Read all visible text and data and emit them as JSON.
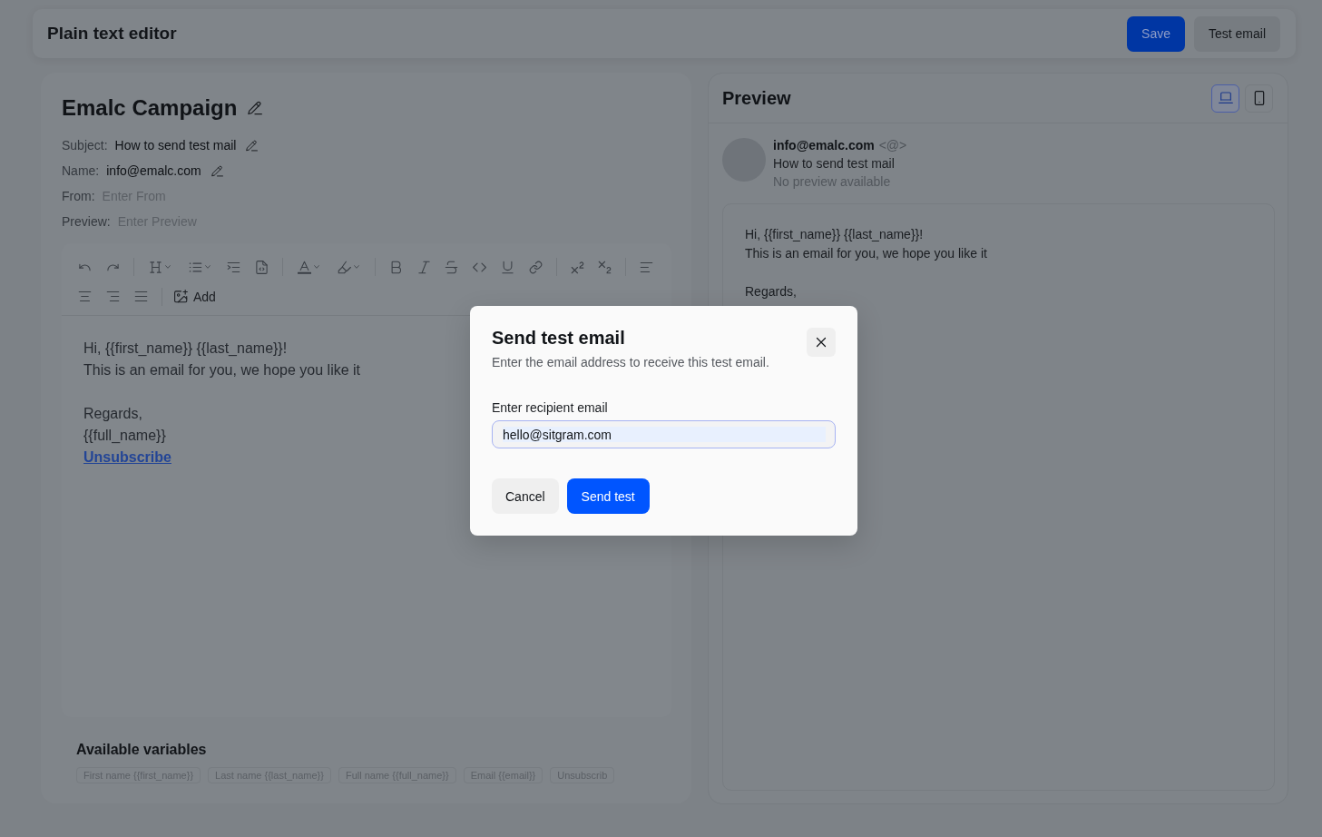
{
  "header": {
    "title": "Plain text editor",
    "buttons": [
      {
        "label": "Save",
        "kind": "primary"
      },
      {
        "label": "Test email",
        "kind": "secondary"
      }
    ]
  },
  "campaign": {
    "title": "Emalc Campaign",
    "fields": [
      {
        "kind": "value",
        "label": "Subject:",
        "value": "How to send test mail"
      },
      {
        "kind": "value",
        "label": "Name:",
        "value": "info@emalc.com"
      },
      {
        "kind": "input",
        "label": "From:",
        "placeholder": "Enter From"
      },
      {
        "kind": "input",
        "label": "Preview:",
        "placeholder": "Enter Preview"
      }
    ]
  },
  "editor": {
    "toolbar": {
      "add_label": "Add"
    },
    "paragraphs": [
      {
        "lines": [
          "Hi, {{first_name}} {{last_name}}!",
          "This is an email for you, we hope you like it"
        ]
      },
      {
        "lines": [
          "Regards,",
          "{{full_name}}"
        ]
      }
    ],
    "link": "Unsubscribe"
  },
  "variables": {
    "title": "Available variables",
    "items": [
      "First name {{first_name}}",
      "Last name {{last_name}}",
      "Full name {{full_name}}",
      "Email {{email}}",
      "Unsubscrib"
    ]
  },
  "preview": {
    "title": "Preview",
    "view_modes": [
      {
        "kind": "laptop",
        "selected": true
      },
      {
        "kind": "phone",
        "selected": false
      }
    ],
    "sender": {
      "email": "info@emalc.com",
      "address": "<@>",
      "subject": "How to send test mail",
      "snippet": "No preview available"
    },
    "paragraphs": [
      {
        "lines": [
          "Hi, {{first_name}} {{last_name}}!",
          "This is an email for you, we hope you like it"
        ]
      },
      {
        "lines": [
          "Regards,"
        ]
      }
    ]
  },
  "dialog": {
    "title": "Send test email",
    "description": "Enter the email address to receive this test email.",
    "field": {
      "label": "Enter recipient email",
      "value": "hello@sitgram.com"
    },
    "buttons": [
      {
        "label": "Cancel",
        "kind": "secondary"
      },
      {
        "label": "Send test",
        "kind": "primary"
      }
    ]
  }
}
